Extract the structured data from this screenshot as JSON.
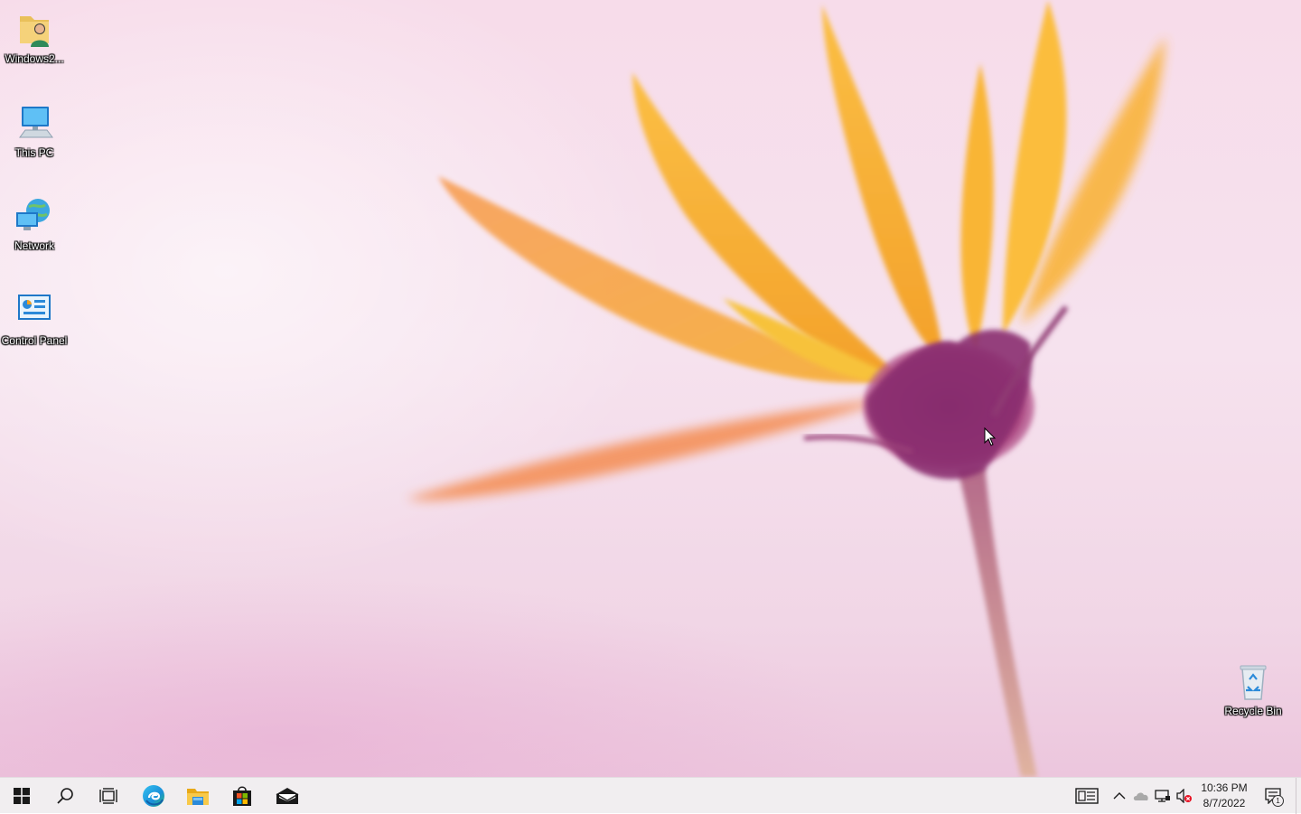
{
  "desktop": {
    "icons": [
      {
        "label": "Windows2...",
        "icon": "user-folder-icon"
      },
      {
        "label": "This PC",
        "icon": "computer-icon"
      },
      {
        "label": "Network",
        "icon": "network-icon"
      },
      {
        "label": "Control Panel",
        "icon": "control-panel-icon"
      },
      {
        "label": "Recycle Bin",
        "icon": "recycle-bin-icon"
      }
    ]
  },
  "taskbar": {
    "pinned": [
      {
        "name": "Start",
        "icon": "windows-start-icon"
      },
      {
        "name": "Search",
        "icon": "search-icon"
      },
      {
        "name": "Task View",
        "icon": "task-view-icon"
      },
      {
        "name": "Microsoft Edge",
        "icon": "edge-icon"
      },
      {
        "name": "File Explorer",
        "icon": "file-explorer-icon"
      },
      {
        "name": "Microsoft Store",
        "icon": "store-icon"
      },
      {
        "name": "Mail",
        "icon": "mail-icon"
      }
    ],
    "tray": {
      "icons": [
        "news-widget-icon",
        "chevron-up-icon",
        "onedrive-cloud-icon",
        "network-status-icon",
        "volume-muted-icon"
      ],
      "clock": {
        "time": "10:36 PM",
        "date": "8/7/2022"
      },
      "notification_count": "1"
    }
  },
  "colors": {
    "taskbar_bg": "#f1eef0",
    "petal_orange": "#f6a623",
    "flower_purple": "#7a2a6a",
    "edge_blue": "#1f9cd8"
  }
}
